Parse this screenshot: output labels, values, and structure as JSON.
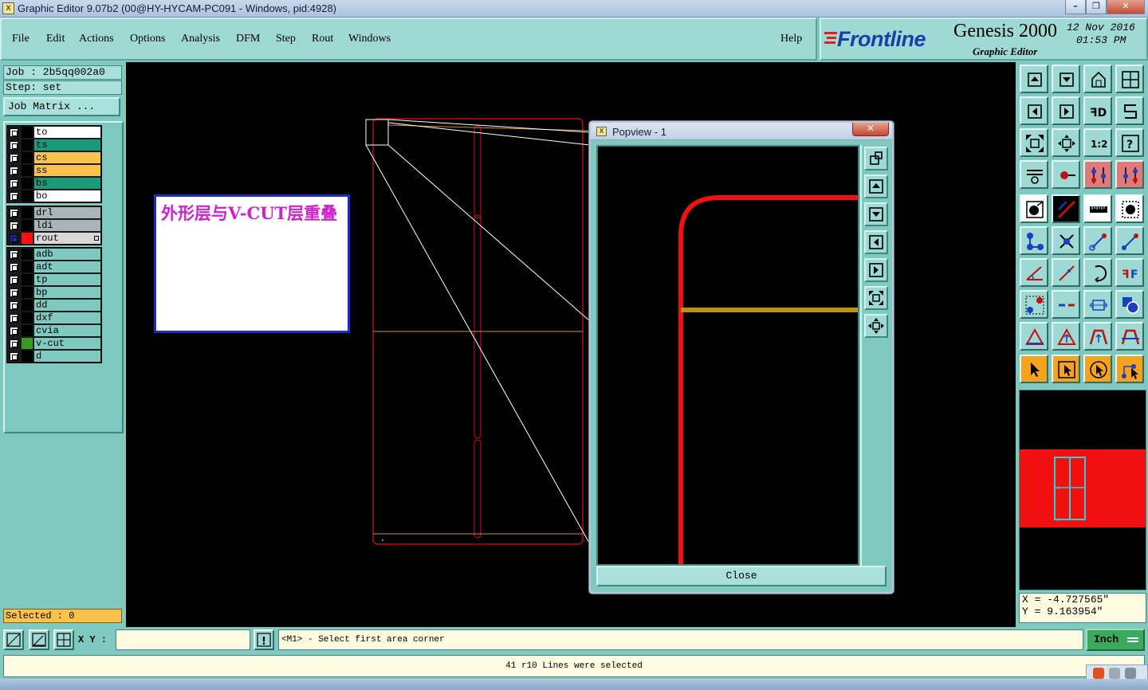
{
  "window": {
    "title": "Graphic Editor 9.07b2 (00@HY-HYCAM-PC091 - Windows, pid:4928)"
  },
  "menu": {
    "items": [
      "File",
      "Edit",
      "Actions",
      "Options",
      "Analysis",
      "DFM",
      "Step",
      "Rout",
      "Windows"
    ],
    "help": "Help"
  },
  "brand": {
    "logo": "Frontline",
    "product": "Genesis 2000",
    "subtitle": "Graphic Editor",
    "date": "12 Nov 2016",
    "time": "01:53 PM"
  },
  "job": {
    "job_label": "Job : 2b5qq002a0",
    "step_label": "Step: set",
    "matrix_button": "Job Matrix ..."
  },
  "layers": {
    "group1": [
      {
        "name": "to",
        "color": "#ffffff"
      },
      {
        "name": "ts",
        "color": "#1a9a78"
      },
      {
        "name": "cs",
        "color": "#f9c24c"
      },
      {
        "name": "ss",
        "color": "#f9c24c"
      },
      {
        "name": "bs",
        "color": "#1a9a78"
      },
      {
        "name": "bo",
        "color": "#ffffff"
      }
    ],
    "group2": [
      {
        "name": "drl",
        "color": "#a8b4b8"
      },
      {
        "name": "ldi",
        "color": "#a8b4b8"
      },
      {
        "name": "rout",
        "color": "#d8d8d8",
        "indicator": "#ff1010",
        "active": true
      }
    ],
    "group3": [
      {
        "name": "adb",
        "color": "#7fc9c0"
      },
      {
        "name": "adt",
        "color": "#7fc9c0"
      },
      {
        "name": "tp",
        "color": "#7fc9c0"
      },
      {
        "name": "bp",
        "color": "#7fc9c0"
      },
      {
        "name": "dd",
        "color": "#7fc9c0"
      },
      {
        "name": "dxf",
        "color": "#7fc9c0"
      },
      {
        "name": "cvia",
        "color": "#7fc9c0"
      },
      {
        "name": "v-cut",
        "color": "#7fc9c0",
        "indicator": "#3a9a20"
      },
      {
        "name": "d",
        "color": "#7fc9c0"
      }
    ]
  },
  "selected_label": "Selected : 0",
  "annotation": {
    "text": "外形层与V-CUT层重叠"
  },
  "popview": {
    "title": "Popview - 1",
    "close_label": "Close"
  },
  "coords": {
    "x": "X = -4.727565\"",
    "y": "Y = 9.163954\""
  },
  "bottom": {
    "xy_label": "X Y :",
    "xy_value": "",
    "prompt": "<M1> - Select first area corner",
    "unit": "Inch",
    "status": "41 r10 Lines were selected"
  },
  "colors": {
    "rout": "#ff1010",
    "vcut": "#b8901c",
    "panel": "#7fc9c0"
  }
}
